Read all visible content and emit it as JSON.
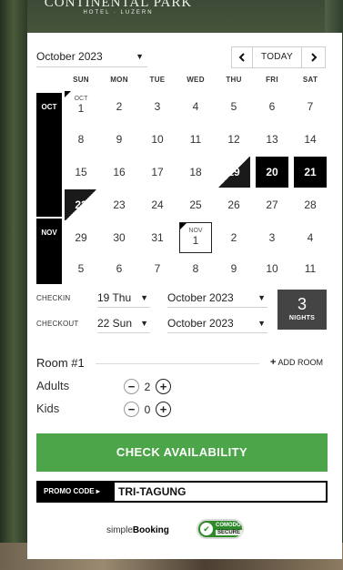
{
  "logo": {
    "line1": "CONTINENTAL PARK",
    "line2": "HOTEL · LUZERN"
  },
  "header": {
    "month_select": "October 2023",
    "today_label": "TODAY"
  },
  "calendar": {
    "weekdays": [
      "SUN",
      "MON",
      "TUE",
      "WED",
      "THU",
      "FRI",
      "SAT"
    ],
    "month_bars": [
      "OCT",
      "NOV"
    ],
    "weeks": [
      [
        "1",
        "2",
        "3",
        "4",
        "5",
        "6",
        "7"
      ],
      [
        "8",
        "9",
        "10",
        "11",
        "12",
        "13",
        "14"
      ],
      [
        "15",
        "16",
        "17",
        "18",
        "19",
        "20",
        "21"
      ],
      [
        "22",
        "23",
        "24",
        "25",
        "26",
        "27",
        "28"
      ],
      [
        "29",
        "30",
        "31",
        "1",
        "2",
        "3",
        "4"
      ],
      [
        "5",
        "6",
        "7",
        "8",
        "9",
        "10",
        "11"
      ]
    ],
    "month_start_labels": {
      "oct": "OCT",
      "nov": "NOV"
    }
  },
  "checkin": {
    "label": "CHECKIN",
    "day": "19 Thu",
    "month": "October 2023"
  },
  "checkout": {
    "label": "CHECKOUT",
    "day": "22 Sun",
    "month": "October 2023"
  },
  "nights": {
    "count": "3",
    "label": "NIGHTS"
  },
  "rooms": {
    "title": "Room #1",
    "add_room": "ADD ROOM",
    "adults_label": "Adults",
    "adults_count": "2",
    "kids_label": "Kids",
    "kids_count": "0"
  },
  "check_button": "CHECK AVAILABILITY",
  "promo": {
    "label": "PROMO CODE ▸",
    "value": "TRI-TAGUNG"
  },
  "footer": {
    "brand_prefix": "simple",
    "brand_bold": "Booking",
    "seal_top": "COMODO",
    "seal_bottom": "SECURE"
  }
}
